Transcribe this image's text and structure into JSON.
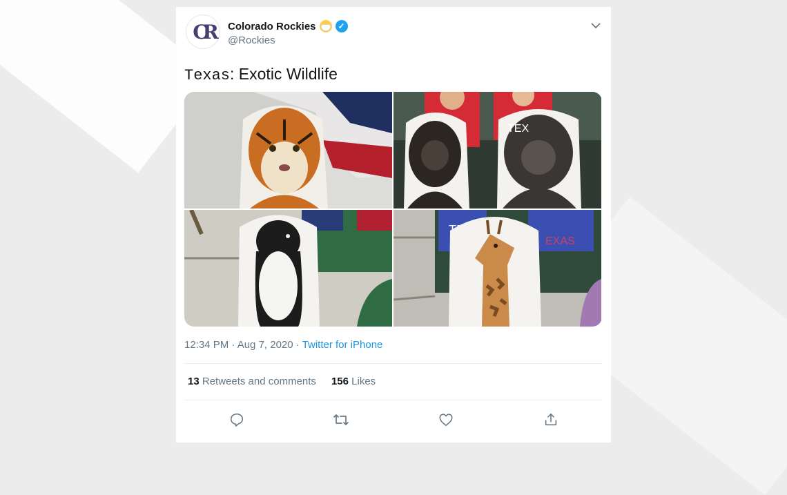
{
  "tweet": {
    "display_name": "Colorado Rockies",
    "handle": "@Rockies",
    "avatar_text": "CR",
    "text_prefix": "Texas",
    "text_rest": ": Exotic Wildlife",
    "timestamp": "12:34 PM · Aug 7, 2020 · ",
    "source": "Twitter for iPhone",
    "retweets_count": "13",
    "retweets_label": "Retweets and comments",
    "likes_count": "156",
    "likes_label": "Likes"
  },
  "media": [
    {
      "subject": "tiger cutout"
    },
    {
      "subject": "gorilla cutouts"
    },
    {
      "subject": "penguin cutout"
    },
    {
      "subject": "giraffe cutout"
    }
  ],
  "icons": {
    "reply": "reply-icon",
    "retweet": "retweet-icon",
    "like": "heart-icon",
    "share": "share-icon"
  },
  "colors": {
    "link": "#1b95e0",
    "verified": "#1da1f2",
    "text": "#14171a",
    "muted": "#657786"
  }
}
